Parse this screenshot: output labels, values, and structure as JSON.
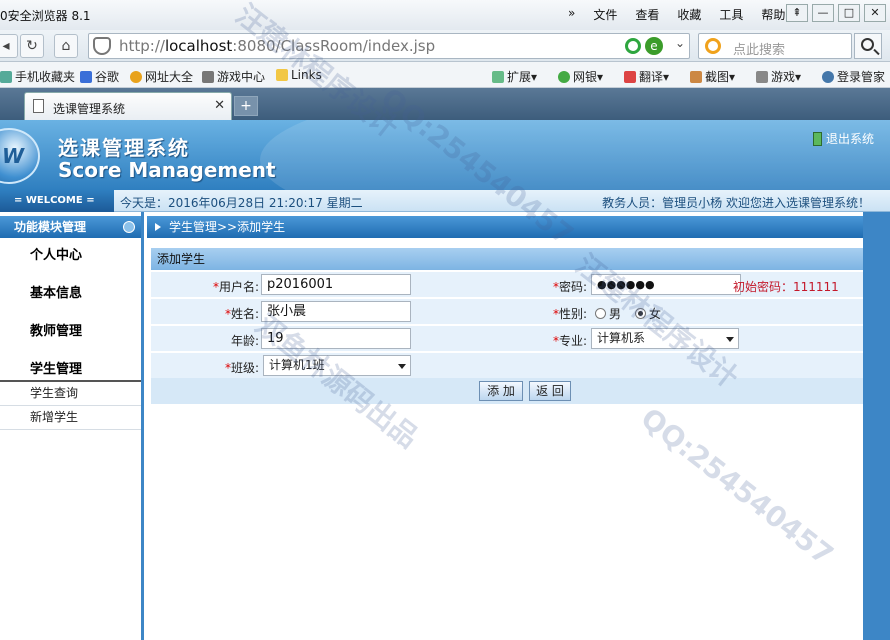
{
  "browser": {
    "title": "0安全浏览器 8.1",
    "menu": [
      "文件",
      "查看",
      "收藏",
      "工具",
      "帮助"
    ],
    "url_prefix": "http://",
    "url_host": "localhost",
    "url_rest": ":8080/ClassRoom/index.jsp",
    "search_placeholder": "点此搜索",
    "bookmarks": [
      "手机收藏夹",
      "谷歌",
      "网址大全",
      "游戏中心",
      "Links"
    ],
    "right_tools": [
      "扩展",
      "网银",
      "翻译",
      "截图",
      "游戏",
      "登录管家"
    ],
    "tab_label": "选课管理系统"
  },
  "app": {
    "title_cn": "选课管理系统",
    "title_en": "Score Management",
    "logout": "退出系统",
    "welcome": "= WELCOME =",
    "today": "今天是：2016年06月28日   21:20:17   星期二",
    "userinfo": "教务人员：管理员小杨   欢迎您进入选课管理系统！"
  },
  "sidebar": {
    "header": "功能模块管理",
    "items": [
      "个人中心",
      "基本信息",
      "教师管理",
      "学生管理"
    ],
    "sub_items": [
      "学生查询",
      "新增学生"
    ]
  },
  "main": {
    "breadcrumb": "学生管理>>添加学生",
    "form_title": "添加学生",
    "username_label": "用户名:",
    "username_value": "p2016001",
    "password_label": "密码:",
    "password_value": "●●●●●●",
    "password_hint": "初始密码：111111",
    "name_label": "姓名:",
    "name_value": "张小晨",
    "gender_label": "性别:",
    "gender_male": "男",
    "gender_female": "女",
    "age_label": "年龄:",
    "age_value": "19",
    "major_label": "专业:",
    "major_value": "计算机系",
    "class_label": "班级:",
    "class_value": "计算机1班",
    "add_button": "添 加",
    "back_button": "返 回"
  },
  "watermarks": [
    "汪建林程序设计",
    "QQ:254540457",
    "双鱼林源码出品"
  ]
}
